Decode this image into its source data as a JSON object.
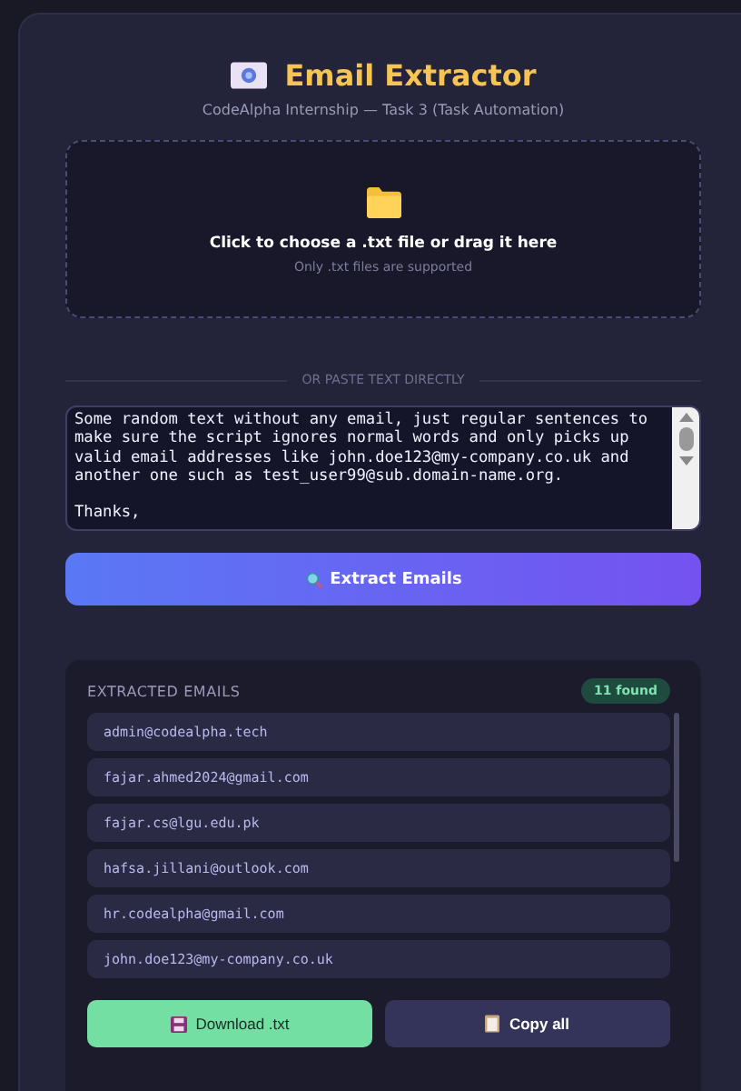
{
  "header": {
    "title": "Email Extractor",
    "subtitle": "CodeAlpha Internship — Task 3 (Task Automation)"
  },
  "dropzone": {
    "prompt": "Click to choose a .txt file or drag it here",
    "hint": "Only .txt files are supported"
  },
  "divider": "OR PASTE TEXT DIRECTLY",
  "text_input": {
    "value": "Some random text without any email, just regular sentences to make sure the script ignores normal words and only picks up valid email addresses like john.doe123@my-company.co.uk and another one such as test_user99@sub.domain-name.org.\n\nThanks,"
  },
  "extract_button": "Extract Emails",
  "results": {
    "title": "EXTRACTED EMAILS",
    "count": "11 found",
    "emails": [
      "admin@codealpha.tech",
      "fajar.ahmed2024@gmail.com",
      "fajar.cs@lgu.edu.pk",
      "hafsa.jillani@outlook.com",
      "hr.codealpha@gmail.com",
      "john.doe123@my-company.co.uk"
    ],
    "buttons": [
      {
        "kind": "download",
        "label": "Download .txt"
      },
      {
        "kind": "copy",
        "label": "Copy all"
      }
    ]
  }
}
